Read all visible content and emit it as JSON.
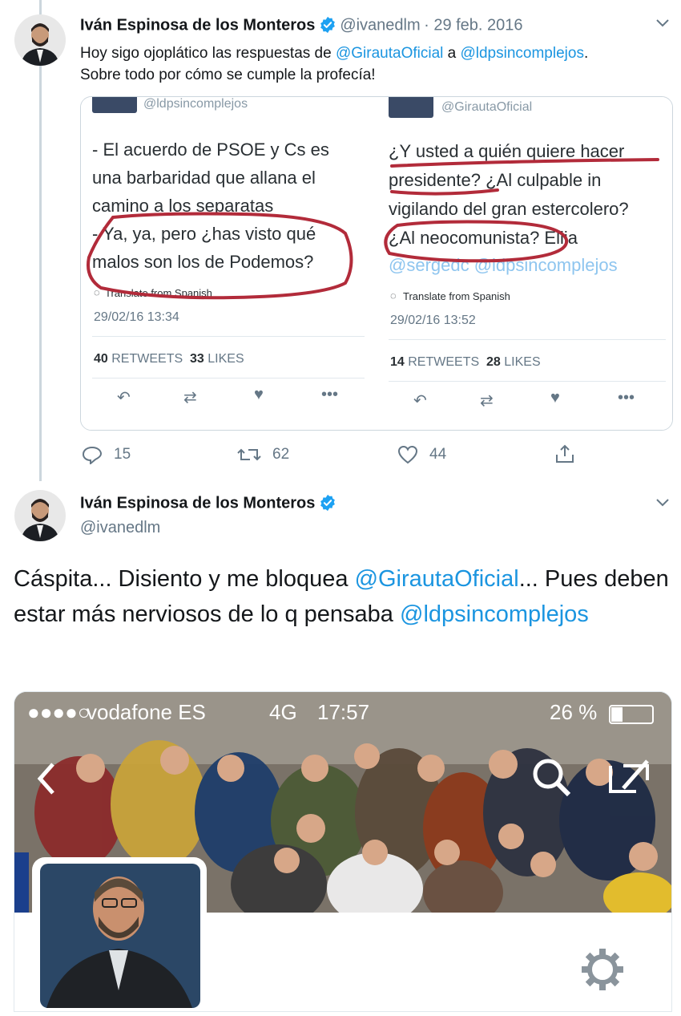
{
  "tweet1": {
    "name": "Iván Espinosa de los Monteros",
    "handle": "@ivanedlm",
    "date": "· 29 feb. 2016",
    "text_a": "Hoy sigo ojoplático las respuestas de ",
    "mention_a": "@GirautaOficial",
    "text_b": " a ",
    "mention_b": "@ldpsincomplejos",
    "text_c": ".",
    "line2": "Sobre todo por cómo se cumple la profecía!",
    "replies": "15",
    "retweets": "62",
    "likes": "44"
  },
  "embed_left": {
    "handle": "@ldpsincomplejos",
    "lines": [
      "- El acuerdo de PSOE y Cs es",
      "una barbaridad que allana el",
      "camino a los separatas",
      "- Ya, ya, pero ¿has visto qué",
      "malos son los de Podemos?"
    ],
    "translate": "Translate from Spanish",
    "date": "29/02/16 13:34",
    "retweets_count": "40",
    "retweets_label": "RETWEETS",
    "likes_count": "33",
    "likes_label": "LIKES"
  },
  "embed_right": {
    "handle": "@GirautaOficial",
    "lines": [
      "¿Y usted a quién quiere hacer",
      "presidente? ¿Al culpable in",
      "vigilando del gran estercolero?",
      "¿Al neocomunista? Elija",
      "@sergedc @ldpsincomplejos"
    ],
    "translate": "Translate from Spanish",
    "date": "29/02/16 13:52",
    "retweets_count": "14",
    "retweets_label": "RETWEETS",
    "likes_count": "28",
    "likes_label": "LIKES"
  },
  "tweet2": {
    "name": "Iván Espinosa de los Monteros",
    "handle": "@ivanedlm",
    "text_a": "Cáspita... Disiento y me bloquea ",
    "mention_a": "@GirautaOficial",
    "text_b": "... Pues deben estar más nerviosos de lo q pensaba ",
    "mention_b": "@ldpsincomplejos"
  },
  "phone_status": {
    "signal": "●●●●○",
    "carrier": "vodafone ES",
    "network": "4G",
    "time": "17:57",
    "battery": "26 %"
  },
  "colors": {
    "link": "#1b95e0",
    "verified": "#1da1f2",
    "annotation": "#b22b3a"
  }
}
